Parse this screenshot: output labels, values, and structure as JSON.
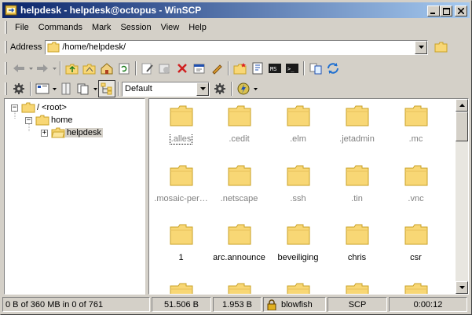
{
  "window": {
    "title": "helpdesk - helpdesk@octopus - WinSCP",
    "minimize_icon": "minimize-icon",
    "maximize_icon": "maximize-icon",
    "close_icon": "close-icon"
  },
  "menu": {
    "items": [
      "File",
      "Commands",
      "Mark",
      "Session",
      "View",
      "Help"
    ]
  },
  "address": {
    "label": "Address",
    "value": "/home/helpdesk/"
  },
  "session_combo": {
    "value": "Default"
  },
  "tree": {
    "nodes": [
      {
        "label": "/ <root>",
        "expander": "−",
        "selected": false
      },
      {
        "label": "home",
        "expander": "−",
        "selected": false
      },
      {
        "label": "helpdesk",
        "expander": "+",
        "selected": true
      }
    ]
  },
  "files": {
    "items": [
      {
        "name": ".alles",
        "hidden": true,
        "focused": true
      },
      {
        "name": ".cedit",
        "hidden": true
      },
      {
        "name": ".elm",
        "hidden": true
      },
      {
        "name": ".jetadmin",
        "hidden": true
      },
      {
        "name": ".mc",
        "hidden": true
      },
      {
        "name": ".mosaic-per…",
        "hidden": true
      },
      {
        "name": ".netscape",
        "hidden": true
      },
      {
        "name": ".ssh",
        "hidden": true
      },
      {
        "name": ".tin",
        "hidden": true
      },
      {
        "name": ".vnc",
        "hidden": true
      },
      {
        "name": "1",
        "hidden": false
      },
      {
        "name": "arc.announce",
        "hidden": false
      },
      {
        "name": "beveiliging",
        "hidden": false
      },
      {
        "name": "chris",
        "hidden": false
      },
      {
        "name": "csr",
        "hidden": false
      },
      {
        "name": "",
        "hidden": false
      },
      {
        "name": "",
        "hidden": false
      },
      {
        "name": "",
        "hidden": false
      },
      {
        "name": "",
        "hidden": false
      },
      {
        "name": "",
        "hidden": false
      }
    ]
  },
  "status": {
    "selection": "0 B of 360 MB in 0 of 761",
    "bytes_sent": "51.506 B",
    "bytes_received": "1.953 B",
    "cipher": "blowfish",
    "protocol": "SCP",
    "duration": "0:00:12"
  },
  "colors": {
    "folder_fill": "#f8d775",
    "folder_edge": "#c9a227",
    "title_start": "#0a246a",
    "title_end": "#a6caf0"
  }
}
